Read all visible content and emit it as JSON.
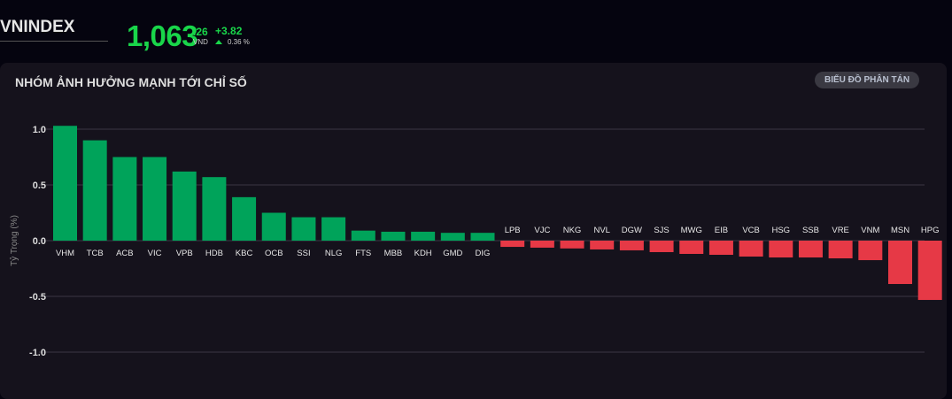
{
  "header": {
    "index_name": "VNINDEX",
    "price": "1,063",
    "price_decimal": ".26",
    "currency": "VND",
    "change": "+3.82",
    "change_pct": "0.36 %"
  },
  "panel": {
    "title": "NHÓM ẢNH HƯỞNG MẠNH TỚI CHỈ SỐ",
    "scatter_button": "BIỂU ĐỒ PHÂN TÁN"
  },
  "colors": {
    "positive": "#00a35a",
    "negative": "#e63946",
    "up": "#19d64a"
  },
  "chart_data": {
    "type": "bar",
    "title": "NHÓM ẢNH HƯỞNG MẠNH TỚI CHỈ SỐ",
    "xlabel": "",
    "ylabel": "Tỷ Trọng (%)",
    "ylim": [
      -1.1,
      1.1
    ],
    "yticks": [
      1.0,
      0.5,
      0.0,
      -0.5,
      -1.0
    ],
    "ytick_labels": [
      "1.0",
      "0.5",
      "0.0",
      "-0.5",
      "-1.0"
    ],
    "grid": true,
    "categories": [
      "VHM",
      "TCB",
      "ACB",
      "VIC",
      "VPB",
      "HDB",
      "KBC",
      "OCB",
      "SSI",
      "NLG",
      "FTS",
      "MBB",
      "KDH",
      "GMD",
      "DIG",
      "LPB",
      "VJC",
      "NKG",
      "NVL",
      "DGW",
      "SJS",
      "MWG",
      "EIB",
      "VCB",
      "HSG",
      "SSB",
      "VRE",
      "VNM",
      "MSN",
      "HPG"
    ],
    "values": [
      1.03,
      0.9,
      0.75,
      0.75,
      0.62,
      0.57,
      0.39,
      0.25,
      0.21,
      0.21,
      0.09,
      0.08,
      0.08,
      0.07,
      0.07,
      -0.056,
      -0.063,
      -0.07,
      -0.079,
      -0.087,
      -0.103,
      -0.119,
      -0.127,
      -0.143,
      -0.151,
      -0.151,
      -0.159,
      -0.175,
      -0.389,
      -0.532
    ]
  }
}
